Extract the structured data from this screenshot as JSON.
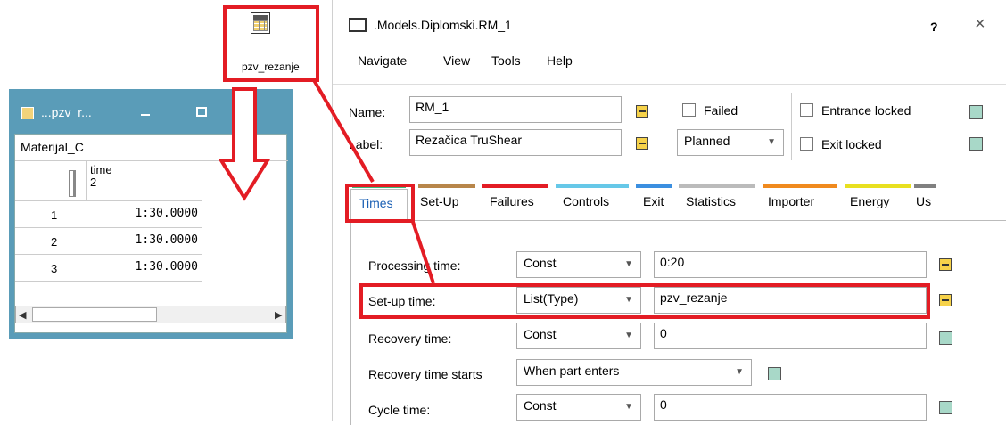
{
  "table_icon": {
    "label": "pzv_rezanje"
  },
  "left_window": {
    "title": "...pzv_r...",
    "object_name": "Materijal_C",
    "column_header": "time",
    "column_index": "2",
    "rows": [
      {
        "index": "1",
        "value": "1:30.0000"
      },
      {
        "index": "2",
        "value": "1:30.0000"
      },
      {
        "index": "3",
        "value": "1:30.0000"
      }
    ]
  },
  "dialog": {
    "title": ".Models.Diplomski.RM_1",
    "help_glyph": "?",
    "close_glyph": "×",
    "menu": [
      "Navigate",
      "View",
      "Tools",
      "Help"
    ],
    "name_label": "Name:",
    "name_value": "RM_1",
    "label_label": "Label:",
    "label_value": "Rezačica TruShear",
    "failed_label": "Failed",
    "planned_value": "Planned",
    "entrance_locked_label": "Entrance locked",
    "exit_locked_label": "Exit locked",
    "tabs": [
      {
        "label": "Times",
        "color": "#3cb878"
      },
      {
        "label": "Set-Up",
        "color": "#b8864a"
      },
      {
        "label": "Failures",
        "color": "#e31c24"
      },
      {
        "label": "Controls",
        "color": "#66c8e8"
      },
      {
        "label": "Exit",
        "color": "#3b8fe0"
      },
      {
        "label": "Statistics",
        "color": "#bbbbbb"
      },
      {
        "label": "Importer",
        "color": "#f08a1e"
      },
      {
        "label": "Energy",
        "color": "#e8e020"
      },
      {
        "label": "Us",
        "color": "#808080"
      }
    ],
    "rows": [
      {
        "label": "Processing time:",
        "type": "Const",
        "value": "0:20"
      },
      {
        "label": "Set-up time:",
        "type": "List(Type)",
        "value": "pzv_rezanje"
      },
      {
        "label": "Recovery time:",
        "type": "Const",
        "value": "0"
      },
      {
        "label": "Recovery time starts",
        "type": "When part enters",
        "value": ""
      },
      {
        "label": "Cycle time:",
        "type": "Const",
        "value": "0"
      }
    ]
  },
  "colors": {
    "highlight": "#e31c24",
    "window_frame": "#5a9cb8"
  }
}
